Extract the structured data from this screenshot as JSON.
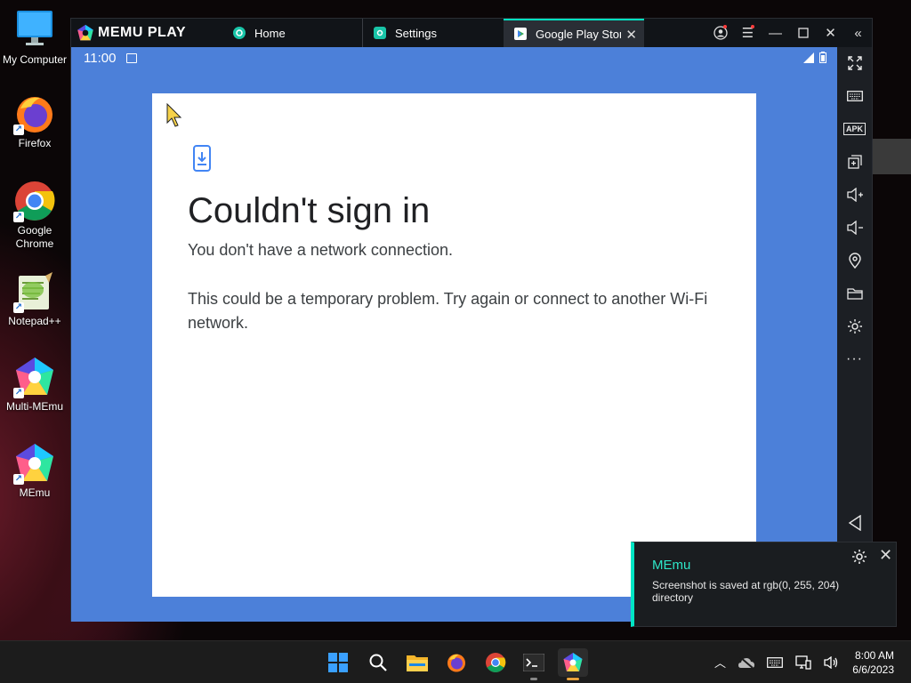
{
  "desktop": {
    "icons": [
      {
        "label": "My Computer",
        "icon": "monitor-icon"
      },
      {
        "label": "Firefox",
        "icon": "firefox-icon"
      },
      {
        "label": "Google\nChrome",
        "icon": "chrome-icon"
      },
      {
        "label": "Notepad++",
        "icon": "notepadpp-icon"
      },
      {
        "label": "Multi-MEmu",
        "icon": "multi-memu-icon"
      },
      {
        "label": "MEmu",
        "icon": "memu-icon"
      }
    ]
  },
  "memu": {
    "brand": "MEMU PLAY",
    "tabs": [
      {
        "label": "Home",
        "icon": "home-tab-icon"
      },
      {
        "label": "Settings",
        "icon": "settings-tab-icon"
      },
      {
        "label": "Google Play Store",
        "icon": "play-store-icon",
        "active": true
      }
    ],
    "accent": "#00e0c0"
  },
  "android": {
    "status": {
      "time": "11:00"
    },
    "dialog": {
      "title": "Couldn't sign in",
      "message1": "You don't have a network connection.",
      "message2": "This could be a temporary problem. Try again or connect to another Wi-Fi network."
    },
    "background": "#4c80d9"
  },
  "sidebar": {
    "tools": [
      "fullscreen-icon",
      "keyboard-icon",
      "apk-icon",
      "multi-window-icon",
      "volume-up-icon",
      "volume-down-icon",
      "location-icon",
      "folder-icon",
      "settings-gear-icon",
      "more-icon",
      "back-icon"
    ],
    "apk_label": "APK"
  },
  "notification": {
    "title": "MEmu",
    "body": "Screenshot is saved at rgb(0, 255, 204) directory"
  },
  "taskbar": {
    "apps": [
      "windows-start-icon",
      "search-icon",
      "file-explorer-icon",
      "firefox-icon",
      "chrome-icon",
      "terminal-icon",
      "memu-icon"
    ],
    "clock": {
      "time": "8:00 AM",
      "date": "6/6/2023"
    }
  }
}
